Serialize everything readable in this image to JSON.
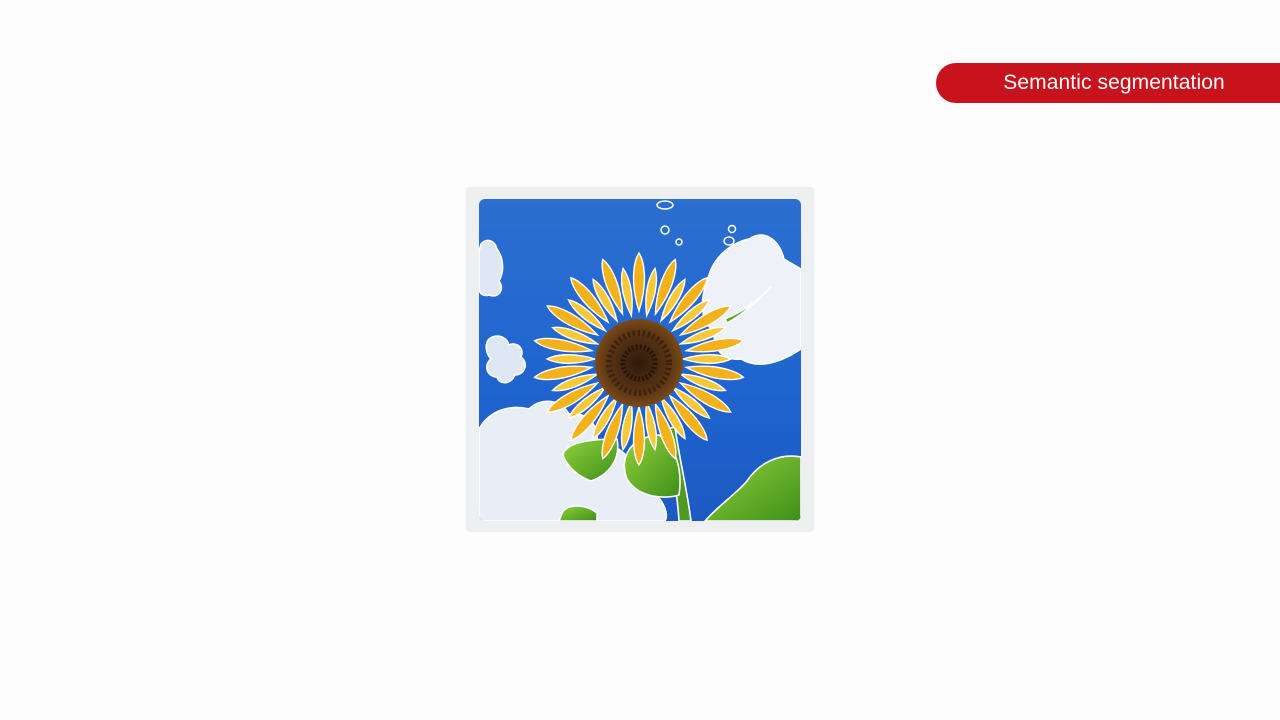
{
  "badge": {
    "label": "Semantic segmentation",
    "color": "#c8131d"
  },
  "image": {
    "subject": "sunflower-against-blue-sky-with-clouds",
    "segments": [
      "sky",
      "clouds",
      "sunflower",
      "leaves",
      "stem"
    ],
    "outline_color": "#ffffff"
  }
}
